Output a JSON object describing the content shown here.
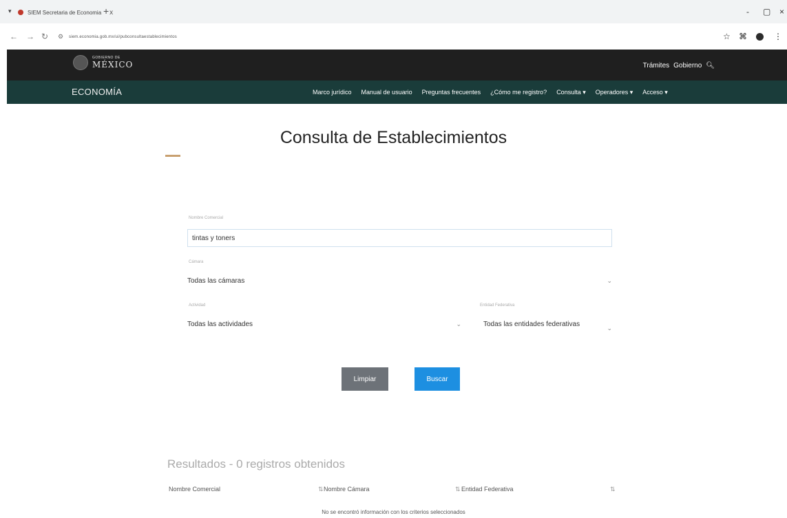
{
  "browser": {
    "tab_menu_icon": "chevron-down-icon",
    "tab_title": "SIEM Secretaria de Economia",
    "tab_close": "x",
    "new_tab": "+",
    "url": "siem.economia.gob.mx/ui/pubconsultaestablecimientos",
    "window_controls": [
      "-",
      "▢",
      "×"
    ],
    "brand_color": "#c0392b"
  },
  "gob_header": {
    "logo_small": "GOBIERNO DE",
    "logo_big": "MÉXICO",
    "links": [
      "Trámites",
      "Gobierno"
    ],
    "bg_color": "#1f1f1f"
  },
  "nav": {
    "brand": "ECONOMÍA",
    "links": [
      "Marco jurídico",
      "Manual de usuario",
      "Preguntas frecuentes",
      "¿Cómo me registro?",
      "Consulta ▾",
      "Operadores ▾",
      "Acceso ▾"
    ],
    "bg_color": "#1a3c3a"
  },
  "main": {
    "title": "Consulta de Establecimientos",
    "form": {
      "nombre_label": "Nombre Comercial",
      "nombre_value": "tintas y toners",
      "camara_label": "Cámara",
      "camara_value": "Todas las cámaras",
      "actividad_label": "Actividad",
      "actividad_value": "Todas las actividades",
      "entidad_label": "Entidad Federativa",
      "entidad_value": "Todas las entidades federativas"
    },
    "buttons": {
      "limpiar": "Limpiar",
      "buscar": "Buscar"
    },
    "results": {
      "title": "Resultados - 0 registros obtenidos",
      "columns": [
        "Nombre Comercial",
        "Nombre Cámara",
        "Entidad Federativa"
      ],
      "empty_message": "No se encontró información con los criterios seleccionados"
    }
  }
}
